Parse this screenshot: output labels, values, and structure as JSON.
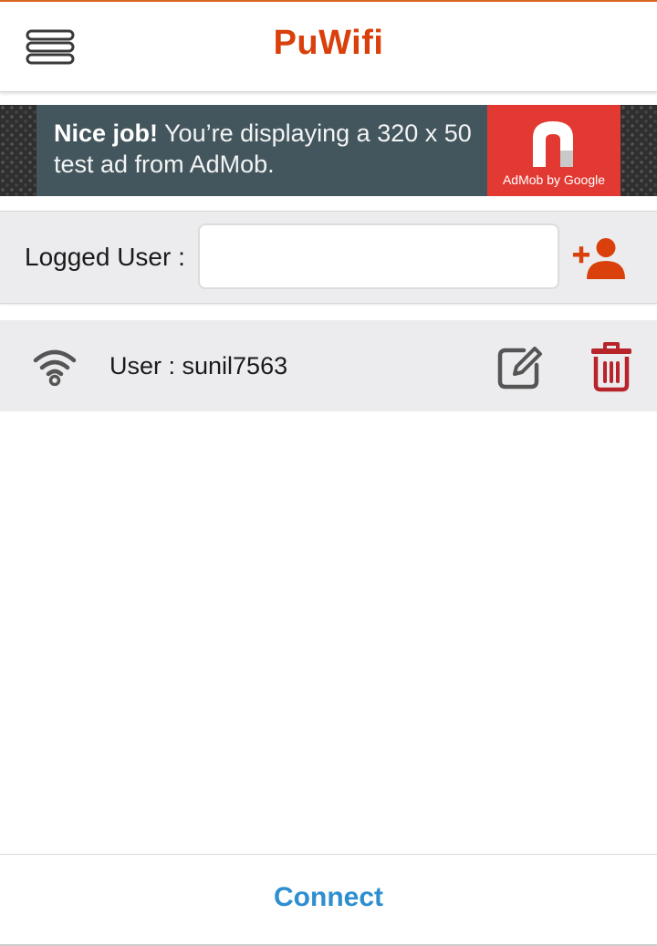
{
  "header": {
    "title": "PuWifi",
    "menu_icon": "hamburger-menu-icon"
  },
  "ad": {
    "bold_text": "Nice job!",
    "text": " You’re displaying a 320 x 50 test ad from AdMob.",
    "logo_caption": "AdMob by Google",
    "logo_icon": "admob-logo-icon"
  },
  "logged_user": {
    "label": "Logged User :",
    "value": "",
    "add_icon": "add-user-icon"
  },
  "users": [
    {
      "label": "User : sunil7563",
      "status_icon": "wifi-icon",
      "edit_icon": "edit-icon",
      "delete_icon": "trash-icon"
    }
  ],
  "footer": {
    "connect_label": "Connect"
  },
  "colors": {
    "brand": "#d9400b",
    "link": "#2d8ed0",
    "delete": "#b7242a",
    "icon_gray": "#555555",
    "ad_background": "#44565d",
    "ad_logo": "#e23a33"
  }
}
